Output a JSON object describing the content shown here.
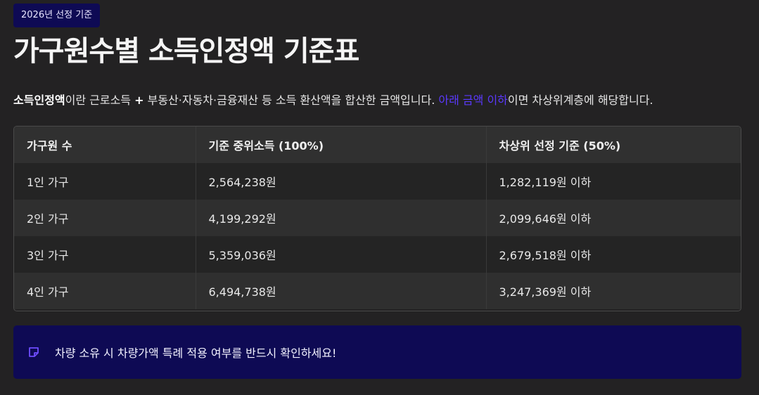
{
  "badge": "2026년 선정 기준",
  "title": "가구원수별 소득인정액 기준표",
  "description": {
    "term": "소득인정액",
    "part1": "이란 근로소득 ",
    "plus": "+",
    "part2": " 부동산·자동차·금융재산 등 소득 환산액을 합산한 금액입니다. ",
    "highlight": "아래 금액 이하",
    "part3": "이면 차상위계층에 해당합니다."
  },
  "table": {
    "headers": [
      "가구원 수",
      "기준 중위소득 (100%)",
      "차상위 선정 기준 (50%)"
    ],
    "rows": [
      [
        "1인 가구",
        "2,564,238원",
        "1,282,119원 이하"
      ],
      [
        "2인 가구",
        "4,199,292원",
        "2,099,646원 이하"
      ],
      [
        "3인 가구",
        "5,359,036원",
        "2,679,518원 이하"
      ],
      [
        "4인 가구",
        "6,494,738원",
        "3,247,369원 이하"
      ]
    ]
  },
  "notice": {
    "icon": "note-icon",
    "text": "차량 소유 시 차량가액 특례 적용 여부를 반드시 확인하세요!"
  },
  "colors": {
    "accent": "#5b39ff",
    "badge_bg": "#0e0a54",
    "background": "#232223"
  }
}
